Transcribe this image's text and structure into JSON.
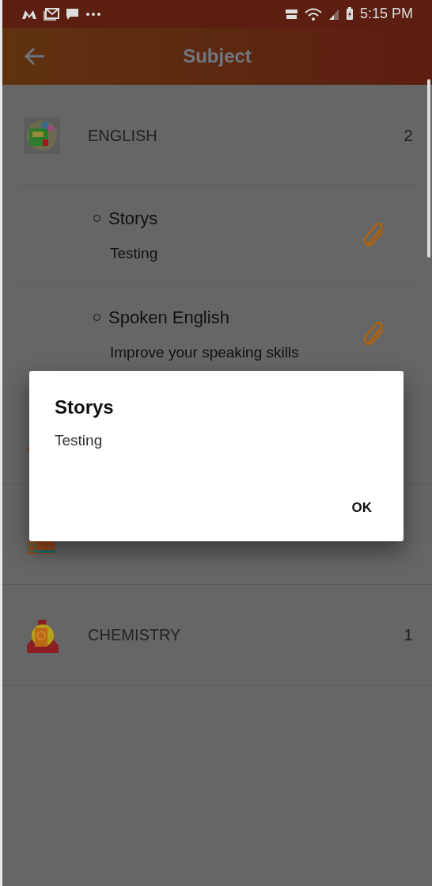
{
  "status_bar": {
    "time": "5:15 PM"
  },
  "app_bar": {
    "title": "Subject"
  },
  "subjects": [
    {
      "kind": "english",
      "name": "ENGLISH",
      "count": "2",
      "topics": [
        {
          "title": "Storys",
          "description": "Testing"
        },
        {
          "title": "Spoken English",
          "description": "Improve your speaking skills"
        }
      ]
    },
    {
      "kind": "math"
    },
    {
      "kind": "physics"
    },
    {
      "kind": "chemistry",
      "name": "CHEMISTRY",
      "count": "1"
    }
  ],
  "dialog": {
    "title": "Storys",
    "message": "Testing",
    "button": "OK"
  }
}
